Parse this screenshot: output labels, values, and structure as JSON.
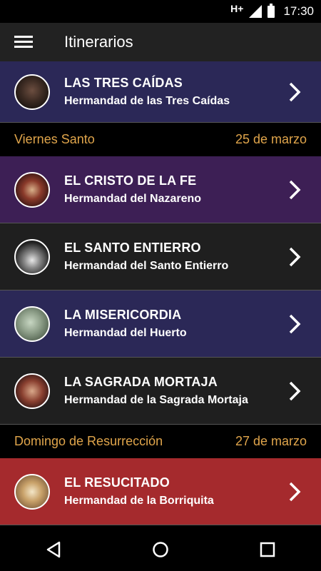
{
  "status": {
    "network": "H+",
    "time": "17:30"
  },
  "appbar": {
    "title": "Itinerarios"
  },
  "list": {
    "first": {
      "title": "LAS TRES CAÍDAS",
      "subtitle": "Hermandad de las Tres Caídas",
      "color": "#2b2857"
    },
    "sections": [
      {
        "day": "Viernes Santo",
        "date": "25 de marzo",
        "items": [
          {
            "title": "EL CRISTO DE LA FE",
            "subtitle": "Hermandad del Nazareno",
            "color": "#3d1f55"
          },
          {
            "title": "EL SANTO ENTIERRO",
            "subtitle": "Hermandad del Santo Entierro",
            "color": "#1f1f1f"
          },
          {
            "title": "LA MISERICORDIA",
            "subtitle": "Hermandad del Huerto",
            "color": "#2b2857"
          },
          {
            "title": "LA SAGRADA MORTAJA",
            "subtitle": "Hermandad de la Sagrada Mortaja",
            "color": "#1f1f1f"
          }
        ]
      },
      {
        "day": "Domingo de Resurrección",
        "date": "27 de marzo",
        "items": [
          {
            "title": "EL RESUCITADO",
            "subtitle": "Hermandad de la Borriquita",
            "color": "#a52a2d"
          }
        ]
      }
    ]
  },
  "colors": {
    "section_text": "#e0a54b",
    "appbar": "#222222"
  }
}
